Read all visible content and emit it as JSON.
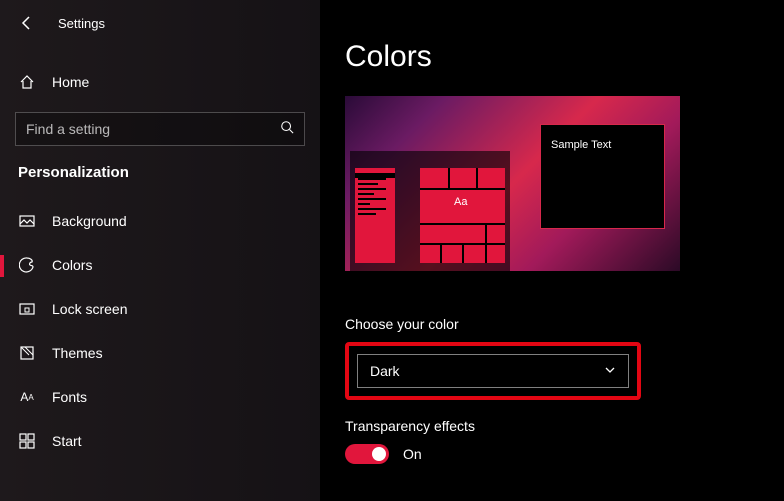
{
  "header": {
    "title": "Settings"
  },
  "search": {
    "placeholder": "Find a setting"
  },
  "home_label": "Home",
  "category": "Personalization",
  "sidebar": {
    "items": [
      {
        "label": "Background"
      },
      {
        "label": "Colors"
      },
      {
        "label": "Lock screen"
      },
      {
        "label": "Themes"
      },
      {
        "label": "Fonts"
      },
      {
        "label": "Start"
      }
    ]
  },
  "main": {
    "title": "Colors",
    "preview": {
      "tile_text": "Aa",
      "window_text": "Sample Text"
    },
    "choose_color": {
      "label": "Choose your color",
      "value": "Dark"
    },
    "transparency": {
      "label": "Transparency effects",
      "state": "On"
    }
  },
  "colors": {
    "accent": "#e1163c"
  }
}
